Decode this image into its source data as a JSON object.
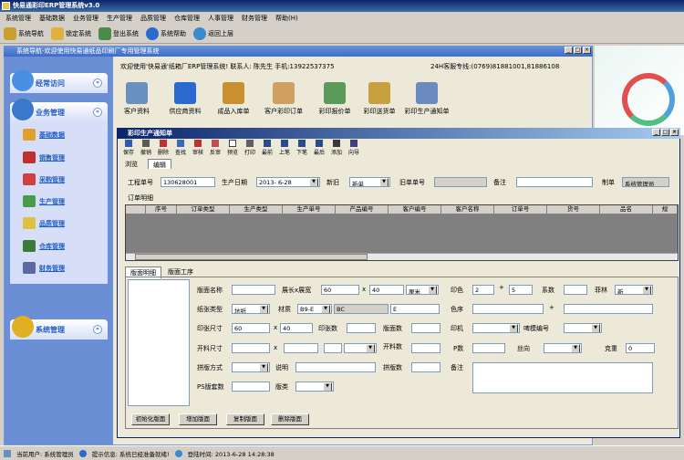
{
  "app": {
    "title": "快易通彩印ERP管理系统v3.0"
  },
  "menu": [
    "系统管理",
    "基础数据",
    "业务管理",
    "生产管理",
    "品质管理",
    "仓库管理",
    "人事管理",
    "财务管理",
    "帮助(H)"
  ],
  "toolbar": [
    {
      "label": "系统导航",
      "icon": "compass-icon"
    },
    {
      "label": "锁定系统",
      "icon": "lock-icon"
    },
    {
      "label": "登出系统",
      "icon": "users-icon"
    },
    {
      "label": "系统帮助",
      "icon": "help-icon"
    },
    {
      "label": "返回上层",
      "icon": "back-icon"
    }
  ],
  "nav_window": {
    "title": "系统导航-欢迎使用快易通纸品印刷厂专用管理系统"
  },
  "welcome": {
    "text": "欢迎使用'快易通'纸箱厂ERP管理系统! 联系人:  陈先生  手机:13922537375",
    "hotline": "24H客服专线:(0769)81881001,81886108"
  },
  "groups": [
    {
      "label": "经常访问"
    },
    {
      "label": "业务管理"
    },
    {
      "label": "系统管理"
    }
  ],
  "nav_items": [
    "基础数据",
    "销售管理",
    "采购管理",
    "生产管理",
    "品质管理",
    "仓库管理",
    "财务管理"
  ],
  "modules": [
    "客户资料",
    "供应商资料",
    "成品入库单",
    "客户彩印订单",
    "彩印报价单",
    "彩印送货单",
    "彩印生产通知单"
  ],
  "form": {
    "title": "彩印生产通知单",
    "tools": [
      "保存",
      "撤销",
      "删除",
      "查找",
      "审核",
      "反审",
      "预览",
      "打印",
      "最前",
      "上笔",
      "下笔",
      "最后",
      "添加",
      "向导"
    ],
    "tabs": [
      "浏览",
      "编辑"
    ],
    "project_no_label": "工程单号",
    "project_no": "130628001",
    "date_label": "生产日期",
    "date": "2013- 6-28",
    "new_old_label": "新旧",
    "new_old": "新单",
    "old_no_label": "旧单单号",
    "old_no": "",
    "remark_label": "备注",
    "remark": "",
    "maker_label": "制单",
    "maker": "系统管理员",
    "detail_label": "订单明细",
    "columns": [
      "序号",
      "订单类型",
      "生产类型",
      "生产单号",
      "产品编号",
      "客户编号",
      "客户名称",
      "订单号",
      "货号",
      "品名",
      "规"
    ],
    "subtabs": [
      "版面明细",
      "版面工序"
    ],
    "fields": {
      "layout_name": "版面名称",
      "lw": "展长x展宽",
      "lw1": "60",
      "x1": "x",
      "lw2": "40",
      "unit": "厘米",
      "color_label": "印色",
      "color1": "2",
      "plus": "+",
      "color2": "5",
      "coef": "系数",
      "film": "菲林",
      "film_val": "新",
      "paper_type": "纸张类型",
      "paper_type_val": "坑纸",
      "material": "材质",
      "mat1": "B9-E",
      "mat2": "BC",
      "mat3": "E",
      "color_seq": "色序",
      "plus2": "+",
      "print_size": "印张尺寸",
      "ps1": "60",
      "ps_x": "x",
      "ps2": "40",
      "print_count": "印张数",
      "layout_count": "版面数",
      "press": "印机",
      "die_no": "啤模编号",
      "cut_size": "开料尺寸",
      "cs_x": "x",
      "cut_count": "开料数",
      "p_count": "P数",
      "grain": "丝向",
      "weight": "克重",
      "weight_val": "0",
      "splice": "拼版方式",
      "note": "说明",
      "splice_count": "拼版数",
      "remark2": "备注",
      "ps_ver": "PS版套数",
      "ver_type": "版类"
    },
    "buttons": [
      "初始化版面",
      "增加版面",
      "复制版面",
      "删除版面"
    ]
  },
  "status": {
    "user": "当前用户: 系统管理员",
    "tip": "提示信息: 系统已经准备就绪!",
    "time": "登陆时间: 2013-6-28 14:28:38"
  }
}
